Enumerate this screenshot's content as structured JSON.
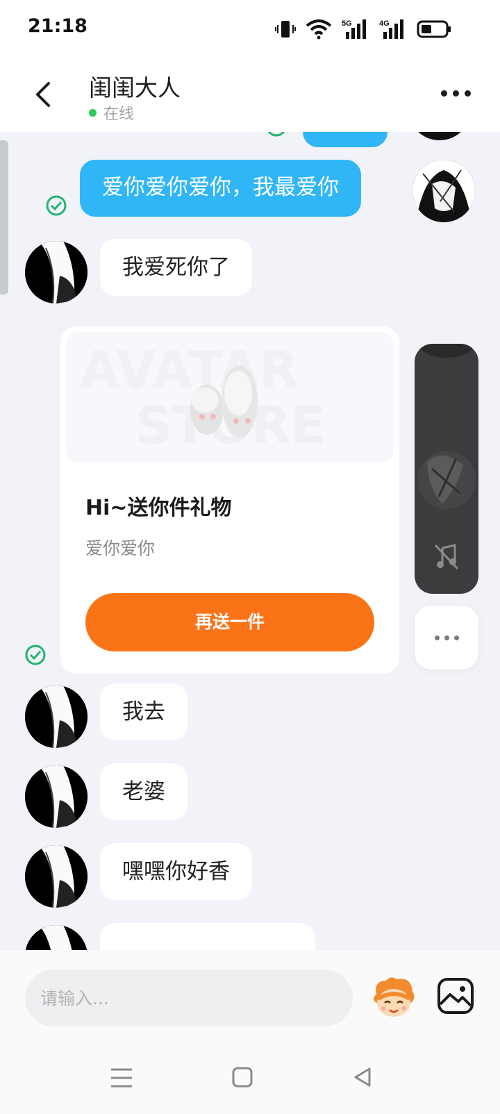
{
  "status_bar": {
    "time": "21:18",
    "net1": "5G",
    "net2": "4G"
  },
  "header": {
    "title": "闺闺大人",
    "status": "在线"
  },
  "messages": {
    "out_1": "爱你爱你爱你，我最爱你",
    "in_1": "我爱死你了",
    "gift_card": {
      "title": "Hi~送你件礼物",
      "subtitle": "爱你爱你",
      "button_label": "再送一件",
      "image_watermark_1": "AVATAR",
      "image_watermark_2": "STORE"
    },
    "in_2": "我去",
    "in_3": "老婆",
    "in_4": "嘿嘿你好香"
  },
  "input": {
    "placeholder": "请输入..."
  },
  "colors": {
    "outgoing_bubble": "#30b6f7",
    "gift_button": "#fa7417",
    "online_dot": "#2ecc5a",
    "check": "#23b46e"
  },
  "icons": [
    "back-arrow-icon",
    "more-dots-icon",
    "check-circle-icon",
    "music-off-icon",
    "emoji-mascot-icon",
    "image-icon",
    "menu-icon",
    "home-square-icon",
    "back-triangle-icon"
  ]
}
